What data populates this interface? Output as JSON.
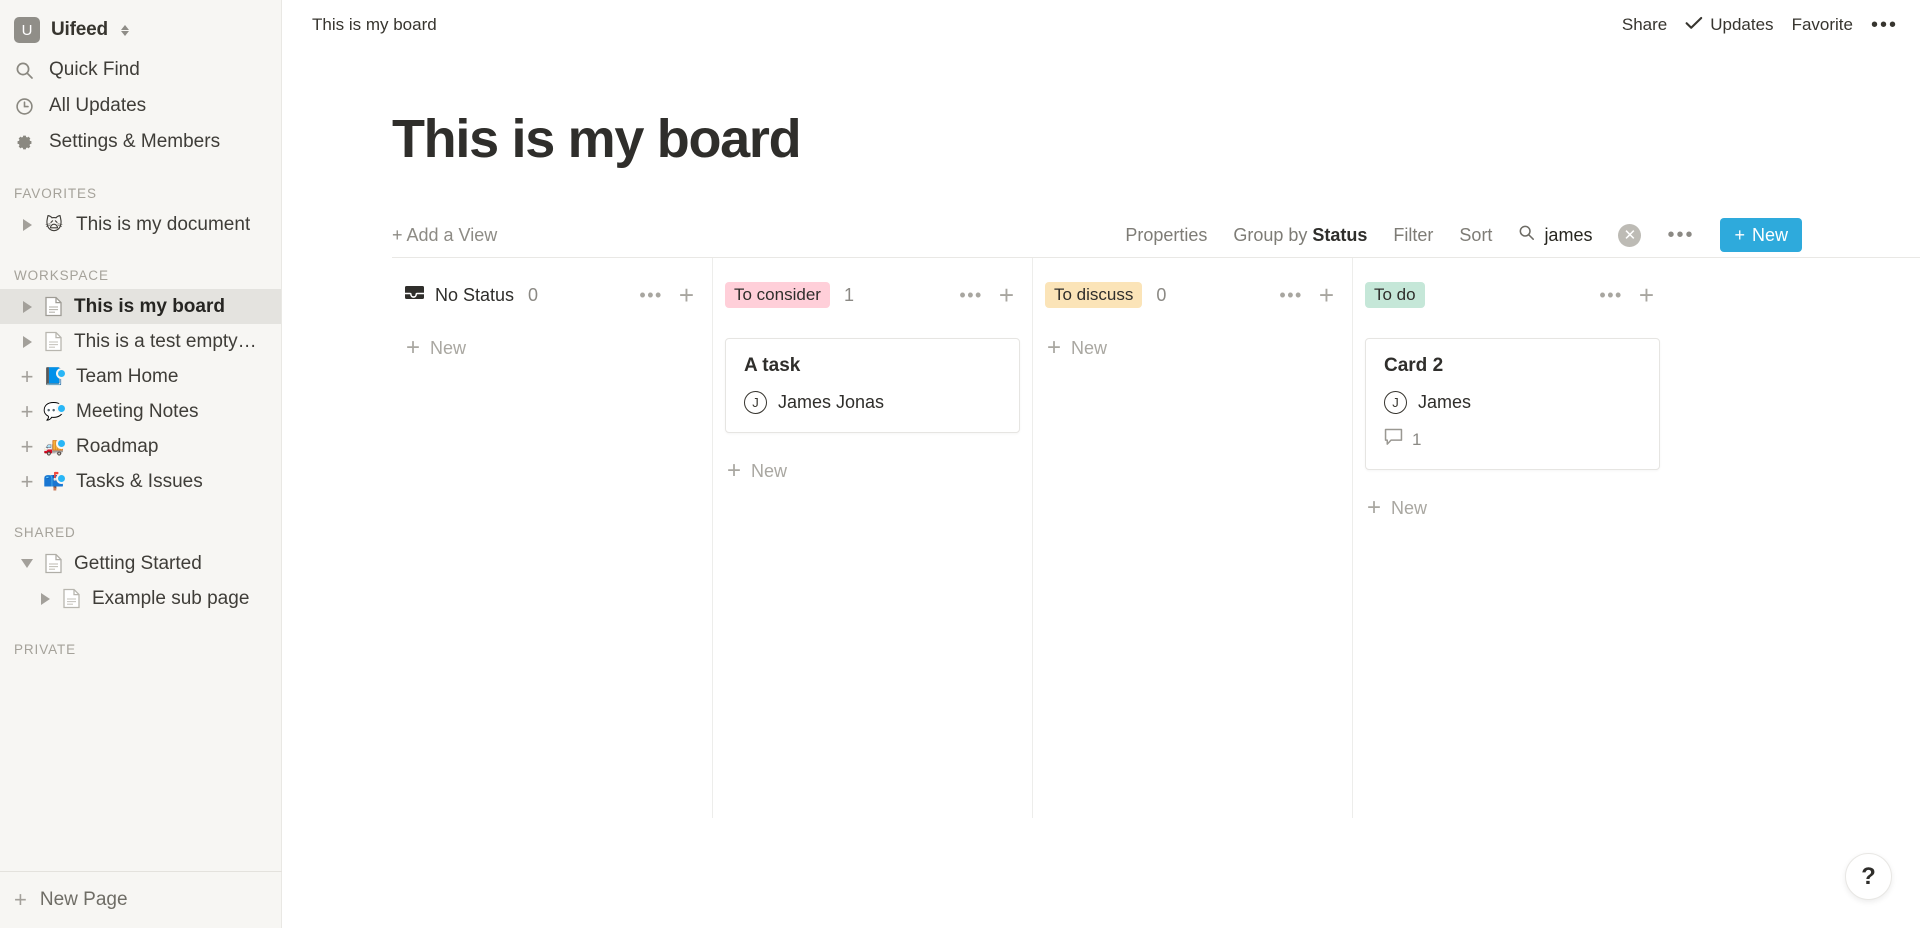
{
  "sidebar": {
    "workspace": {
      "logo_letter": "U",
      "name": "Uifeed"
    },
    "nav": [
      {
        "label": "Quick Find",
        "icon": "search-icon"
      },
      {
        "label": "All Updates",
        "icon": "clock-icon"
      },
      {
        "label": "Settings & Members",
        "icon": "gear-icon"
      }
    ],
    "sections": [
      {
        "label": "FAVORITES",
        "items": [
          {
            "label": "This is my document",
            "twisty": "right",
            "icon": "cat-emoji",
            "emoji": "🙀",
            "dot": false,
            "active": false,
            "indent": false
          }
        ]
      },
      {
        "label": "WORKSPACE",
        "items": [
          {
            "label": "This is my board",
            "twisty": "right",
            "icon": "page-icon",
            "active": true,
            "indent": false
          },
          {
            "label": "This is a test empty…",
            "twisty": "right",
            "icon": "page-icon",
            "active": false,
            "indent": false
          },
          {
            "label": "Team Home",
            "twisty": "plus",
            "icon": "book-emoji",
            "emoji": "📘",
            "dot": true,
            "active": false,
            "indent": false
          },
          {
            "label": "Meeting Notes",
            "twisty": "plus",
            "icon": "speech-emoji",
            "emoji": "💬",
            "dot": true,
            "active": false,
            "indent": false
          },
          {
            "label": "Roadmap",
            "twisty": "plus",
            "icon": "truck-emoji",
            "emoji": "🚚",
            "dot": true,
            "active": false,
            "indent": false
          },
          {
            "label": "Tasks & Issues",
            "twisty": "plus",
            "icon": "mailbox-emoji",
            "emoji": "📫",
            "dot": true,
            "active": false,
            "indent": false
          }
        ]
      },
      {
        "label": "SHARED",
        "items": [
          {
            "label": "Getting Started",
            "twisty": "down",
            "icon": "page-icon",
            "active": false,
            "indent": false
          },
          {
            "label": "Example sub page",
            "twisty": "right",
            "icon": "page-icon",
            "active": false,
            "indent": true
          }
        ]
      },
      {
        "label": "PRIVATE",
        "items": []
      }
    ],
    "new_page_label": "New Page"
  },
  "topbar": {
    "breadcrumb": "This is my board",
    "share_label": "Share",
    "updates_label": "Updates",
    "favorite_label": "Favorite",
    "more_label": "•••"
  },
  "page": {
    "title": "This is my board"
  },
  "toolbar": {
    "add_view_label": "+ Add a View",
    "properties_label": "Properties",
    "group_by_prefix": "Group by ",
    "group_by_value": "Status",
    "filter_label": "Filter",
    "sort_label": "Sort",
    "search_value": "james",
    "search_placeholder": "Search",
    "more_label": "•••",
    "new_label": "New",
    "accent_color": "#2eaadc"
  },
  "board": {
    "columns": [
      {
        "title": "No Status",
        "chip": false,
        "chip_class": "",
        "count": "0",
        "new_label": "New",
        "cards": []
      },
      {
        "title": "To consider",
        "chip": true,
        "chip_class": "chip-pink",
        "chip_color": "#ffcfd9",
        "count": "1",
        "new_label": "New",
        "cards": [
          {
            "title": "A task",
            "person": "James Jonas",
            "avatar_letter": "J",
            "comments": null
          }
        ]
      },
      {
        "title": "To discuss",
        "chip": true,
        "chip_class": "chip-yellow",
        "chip_color": "#fbe4b8",
        "count": "0",
        "new_label": "New",
        "cards": []
      },
      {
        "title": "To do",
        "chip": true,
        "chip_class": "chip-green",
        "chip_color": "#c5e7d8",
        "count": "",
        "new_label": "New",
        "cards": [
          {
            "title": "Card 2",
            "person": "James",
            "avatar_letter": "J",
            "comments": "1"
          }
        ]
      }
    ]
  },
  "help": {
    "label": "?"
  }
}
